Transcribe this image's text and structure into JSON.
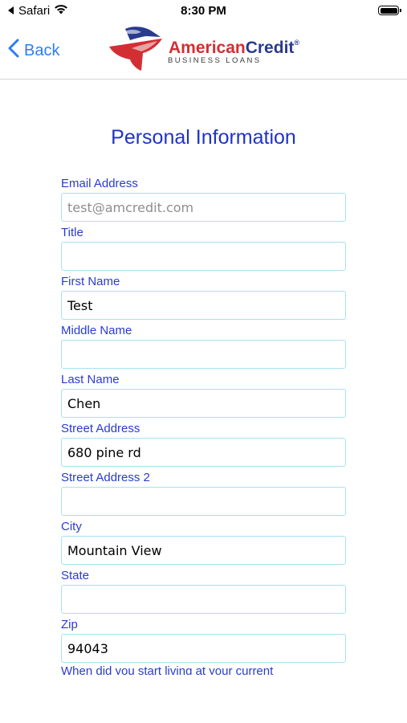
{
  "status_bar": {
    "carrier": "Safari",
    "time": "8:30 PM"
  },
  "nav": {
    "back_label": "Back",
    "logo": {
      "brand_part1": "American",
      "brand_part2": "Credit",
      "registered": "®",
      "tagline": "BUSINESS LOANS"
    }
  },
  "form": {
    "title": "Personal Information",
    "fields": [
      {
        "label": "Email Address",
        "value": "",
        "placeholder": "test@amcredit.com"
      },
      {
        "label": "Title",
        "value": "",
        "placeholder": ""
      },
      {
        "label": "First Name",
        "value": "Test",
        "placeholder": ""
      },
      {
        "label": "Middle Name",
        "value": "",
        "placeholder": ""
      },
      {
        "label": "Last Name",
        "value": "Chen",
        "placeholder": ""
      },
      {
        "label": "Street Address",
        "value": "680 pine rd",
        "placeholder": ""
      },
      {
        "label": "Street Address 2",
        "value": "",
        "placeholder": ""
      },
      {
        "label": "City",
        "value": "Mountain View",
        "placeholder": ""
      },
      {
        "label": "State",
        "value": "",
        "placeholder": ""
      },
      {
        "label": "Zip",
        "value": "94043",
        "placeholder": ""
      }
    ],
    "next_question_partial": "When did you start living at your current"
  },
  "colors": {
    "accent": "#2f7cf6",
    "heading": "#1f34c4",
    "label": "#2a3bd0",
    "input_border": "#a6e1f2",
    "brand_red": "#d22f34",
    "brand_navy": "#2a3a8f"
  }
}
